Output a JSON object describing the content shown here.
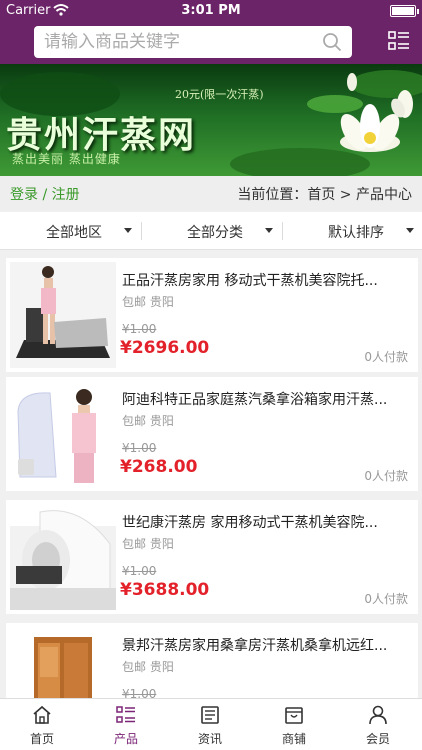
{
  "status_bar": {
    "carrier": "Carrier",
    "time": "3:01 PM"
  },
  "header": {
    "search_placeholder": "请输入商品关键字"
  },
  "banner": {
    "title": "贵州汗蒸网",
    "subtitle": "20元(限一次汗蒸)",
    "slogan": "蒸出美丽    蒸出健康"
  },
  "account": {
    "login_register": "登录 / 注册"
  },
  "breadcrumb": {
    "text": "当前位置：首页 > 产品中心"
  },
  "filters": [
    {
      "label": "全部地区"
    },
    {
      "label": "全部分类"
    },
    {
      "label": "默认排序"
    }
  ],
  "products": [
    {
      "name": "正品汗蒸房家用 移动式干蒸机美容院托...",
      "location": "包邮 贵阳",
      "original_price": "¥1.00",
      "price": "¥2696.00",
      "buyers": "0人付款"
    },
    {
      "name": "阿迪科特正品家庭蒸汽桑拿浴箱家用汗蒸...",
      "location": "包邮 贵阳",
      "original_price": "¥1.00",
      "price": "¥268.00",
      "buyers": "0人付款"
    },
    {
      "name": "世纪康汗蒸房 家用移动式干蒸机美容院...",
      "location": "包邮 贵阳",
      "original_price": "¥1.00",
      "price": "¥3688.00",
      "buyers": "0人付款"
    },
    {
      "name": "景邦汗蒸房家用桑拿房汗蒸机桑拿机远红...",
      "location": "包邮 贵阳",
      "original_price": "¥1.00",
      "price": "",
      "buyers": ""
    }
  ],
  "tabs": [
    {
      "label": "首页",
      "icon": "home-icon"
    },
    {
      "label": "产品",
      "icon": "product-list-icon"
    },
    {
      "label": "资讯",
      "icon": "news-icon"
    },
    {
      "label": "商铺",
      "icon": "store-icon"
    },
    {
      "label": "会员",
      "icon": "user-icon"
    }
  ],
  "colors": {
    "header_bg": "#6b2467",
    "price": "#e3212a",
    "login": "#3a9a2a",
    "active_tab": "#7b2476"
  }
}
